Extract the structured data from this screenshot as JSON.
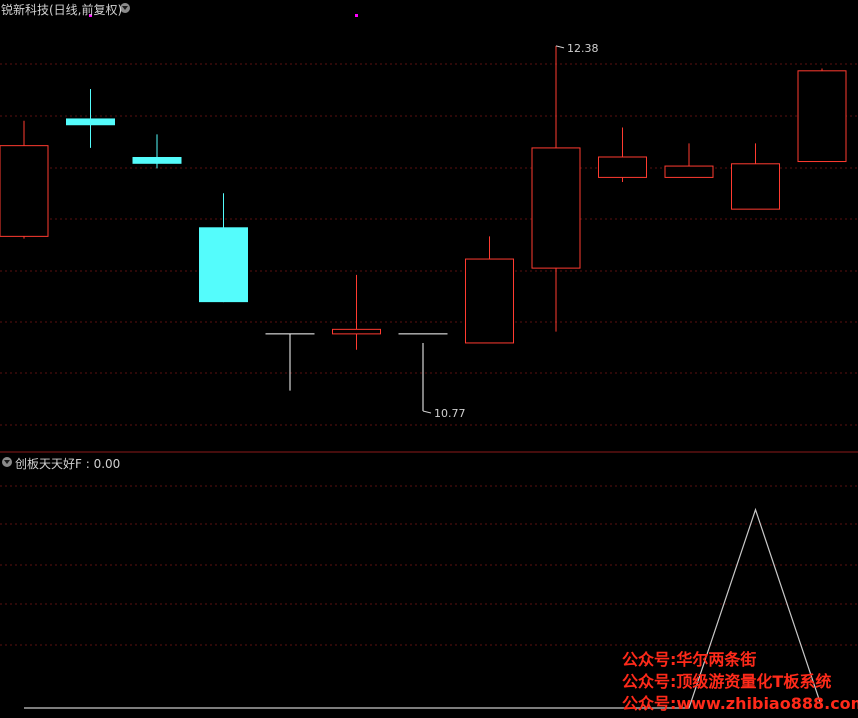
{
  "header": {
    "title": "锐新科技(日线,前复权)"
  },
  "indicator": {
    "label": "创板天天好F : 0.00"
  },
  "watermark": {
    "line1": "公众号:华尔两条街",
    "line2": "公众号:顶级游资量化T板系统",
    "line3": "公众号:www.zhibiao888.com"
  },
  "colors": {
    "background": "#000000",
    "up": "#ff3b30",
    "down": "#54fcfc",
    "flat": "#ffffff",
    "grid": "#5a1010",
    "separator": "#8b1a1a",
    "indicator_line": "#c8c8c8",
    "marker": "#ff00ff",
    "watermark": "#ff2a1a"
  },
  "chart_data": [
    {
      "type": "candlestick",
      "title": "锐新科技(日线,前复权)",
      "ylim": [
        10.62,
        12.45
      ],
      "annotations": [
        {
          "text": "12.38",
          "value": 12.38,
          "candle_index": 8
        },
        {
          "text": "10.77",
          "value": 10.77,
          "candle_index": 6
        }
      ],
      "candles": [
        {
          "open": 11.54,
          "high": 12.05,
          "low": 11.53,
          "close": 11.94,
          "color": "up"
        },
        {
          "open": 12.03,
          "high": 12.19,
          "low": 11.93,
          "close": 12.06,
          "color": "down"
        },
        {
          "open": 11.89,
          "high": 11.99,
          "low": 11.84,
          "close": 11.86,
          "color": "down"
        },
        {
          "open": 11.25,
          "high": 11.73,
          "low": 11.25,
          "close": 11.58,
          "color": "down"
        },
        {
          "open": 10.8,
          "high": 11.11,
          "low": 10.86,
          "close": 11.11,
          "color": "flat"
        },
        {
          "open": 11.13,
          "high": 11.37,
          "low": 11.04,
          "close": 11.11,
          "color": "up"
        },
        {
          "open": 11.15,
          "high": 11.07,
          "low": 10.77,
          "close": 11.11,
          "color": "flat"
        },
        {
          "open": 11.07,
          "high": 11.54,
          "low": 11.07,
          "close": 11.44,
          "color": "up"
        },
        {
          "open": 11.4,
          "high": 12.38,
          "low": 11.12,
          "close": 11.93,
          "color": "up"
        },
        {
          "open": 11.8,
          "high": 12.02,
          "low": 11.78,
          "close": 11.89,
          "color": "up"
        },
        {
          "open": 11.8,
          "high": 11.95,
          "low": 11.8,
          "close": 11.85,
          "color": "up"
        },
        {
          "open": 11.66,
          "high": 11.95,
          "low": 11.66,
          "close": 11.86,
          "color": "up"
        },
        {
          "open": 11.87,
          "high": 12.28,
          "low": 11.87,
          "close": 12.27,
          "color": "up"
        }
      ],
      "markers": [
        {
          "candle_index": 1
        },
        {
          "candle_index": 5
        }
      ],
      "grid": true
    },
    {
      "type": "line",
      "title": "创板天天好F",
      "series": [
        {
          "values": [
            0,
            0,
            0,
            0,
            0,
            0,
            0,
            0,
            0,
            0,
            0,
            1,
            0
          ]
        }
      ],
      "ylim": [
        0,
        1.2
      ],
      "grid": true
    }
  ]
}
